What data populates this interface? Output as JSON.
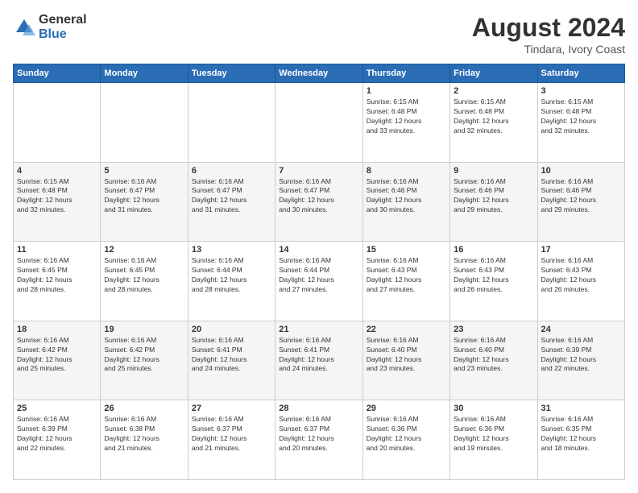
{
  "header": {
    "logo_general": "General",
    "logo_blue": "Blue",
    "main_title": "August 2024",
    "subtitle": "Tindara, Ivory Coast"
  },
  "days_of_week": [
    "Sunday",
    "Monday",
    "Tuesday",
    "Wednesday",
    "Thursday",
    "Friday",
    "Saturday"
  ],
  "weeks": [
    [
      {
        "day": "",
        "info": ""
      },
      {
        "day": "",
        "info": ""
      },
      {
        "day": "",
        "info": ""
      },
      {
        "day": "",
        "info": ""
      },
      {
        "day": "1",
        "info": "Sunrise: 6:15 AM\nSunset: 6:48 PM\nDaylight: 12 hours\nand 33 minutes."
      },
      {
        "day": "2",
        "info": "Sunrise: 6:15 AM\nSunset: 6:48 PM\nDaylight: 12 hours\nand 32 minutes."
      },
      {
        "day": "3",
        "info": "Sunrise: 6:15 AM\nSunset: 6:48 PM\nDaylight: 12 hours\nand 32 minutes."
      }
    ],
    [
      {
        "day": "4",
        "info": "Sunrise: 6:15 AM\nSunset: 6:48 PM\nDaylight: 12 hours\nand 32 minutes."
      },
      {
        "day": "5",
        "info": "Sunrise: 6:16 AM\nSunset: 6:47 PM\nDaylight: 12 hours\nand 31 minutes."
      },
      {
        "day": "6",
        "info": "Sunrise: 6:16 AM\nSunset: 6:47 PM\nDaylight: 12 hours\nand 31 minutes."
      },
      {
        "day": "7",
        "info": "Sunrise: 6:16 AM\nSunset: 6:47 PM\nDaylight: 12 hours\nand 30 minutes."
      },
      {
        "day": "8",
        "info": "Sunrise: 6:16 AM\nSunset: 6:46 PM\nDaylight: 12 hours\nand 30 minutes."
      },
      {
        "day": "9",
        "info": "Sunrise: 6:16 AM\nSunset: 6:46 PM\nDaylight: 12 hours\nand 29 minutes."
      },
      {
        "day": "10",
        "info": "Sunrise: 6:16 AM\nSunset: 6:46 PM\nDaylight: 12 hours\nand 29 minutes."
      }
    ],
    [
      {
        "day": "11",
        "info": "Sunrise: 6:16 AM\nSunset: 6:45 PM\nDaylight: 12 hours\nand 28 minutes."
      },
      {
        "day": "12",
        "info": "Sunrise: 6:16 AM\nSunset: 6:45 PM\nDaylight: 12 hours\nand 28 minutes."
      },
      {
        "day": "13",
        "info": "Sunrise: 6:16 AM\nSunset: 6:44 PM\nDaylight: 12 hours\nand 28 minutes."
      },
      {
        "day": "14",
        "info": "Sunrise: 6:16 AM\nSunset: 6:44 PM\nDaylight: 12 hours\nand 27 minutes."
      },
      {
        "day": "15",
        "info": "Sunrise: 6:16 AM\nSunset: 6:43 PM\nDaylight: 12 hours\nand 27 minutes."
      },
      {
        "day": "16",
        "info": "Sunrise: 6:16 AM\nSunset: 6:43 PM\nDaylight: 12 hours\nand 26 minutes."
      },
      {
        "day": "17",
        "info": "Sunrise: 6:16 AM\nSunset: 6:43 PM\nDaylight: 12 hours\nand 26 minutes."
      }
    ],
    [
      {
        "day": "18",
        "info": "Sunrise: 6:16 AM\nSunset: 6:42 PM\nDaylight: 12 hours\nand 25 minutes."
      },
      {
        "day": "19",
        "info": "Sunrise: 6:16 AM\nSunset: 6:42 PM\nDaylight: 12 hours\nand 25 minutes."
      },
      {
        "day": "20",
        "info": "Sunrise: 6:16 AM\nSunset: 6:41 PM\nDaylight: 12 hours\nand 24 minutes."
      },
      {
        "day": "21",
        "info": "Sunrise: 6:16 AM\nSunset: 6:41 PM\nDaylight: 12 hours\nand 24 minutes."
      },
      {
        "day": "22",
        "info": "Sunrise: 6:16 AM\nSunset: 6:40 PM\nDaylight: 12 hours\nand 23 minutes."
      },
      {
        "day": "23",
        "info": "Sunrise: 6:16 AM\nSunset: 6:40 PM\nDaylight: 12 hours\nand 23 minutes."
      },
      {
        "day": "24",
        "info": "Sunrise: 6:16 AM\nSunset: 6:39 PM\nDaylight: 12 hours\nand 22 minutes."
      }
    ],
    [
      {
        "day": "25",
        "info": "Sunrise: 6:16 AM\nSunset: 6:39 PM\nDaylight: 12 hours\nand 22 minutes."
      },
      {
        "day": "26",
        "info": "Sunrise: 6:16 AM\nSunset: 6:38 PM\nDaylight: 12 hours\nand 21 minutes."
      },
      {
        "day": "27",
        "info": "Sunrise: 6:16 AM\nSunset: 6:37 PM\nDaylight: 12 hours\nand 21 minutes."
      },
      {
        "day": "28",
        "info": "Sunrise: 6:16 AM\nSunset: 6:37 PM\nDaylight: 12 hours\nand 20 minutes."
      },
      {
        "day": "29",
        "info": "Sunrise: 6:16 AM\nSunset: 6:36 PM\nDaylight: 12 hours\nand 20 minutes."
      },
      {
        "day": "30",
        "info": "Sunrise: 6:16 AM\nSunset: 6:36 PM\nDaylight: 12 hours\nand 19 minutes."
      },
      {
        "day": "31",
        "info": "Sunrise: 6:16 AM\nSunset: 6:35 PM\nDaylight: 12 hours\nand 18 minutes."
      }
    ]
  ]
}
